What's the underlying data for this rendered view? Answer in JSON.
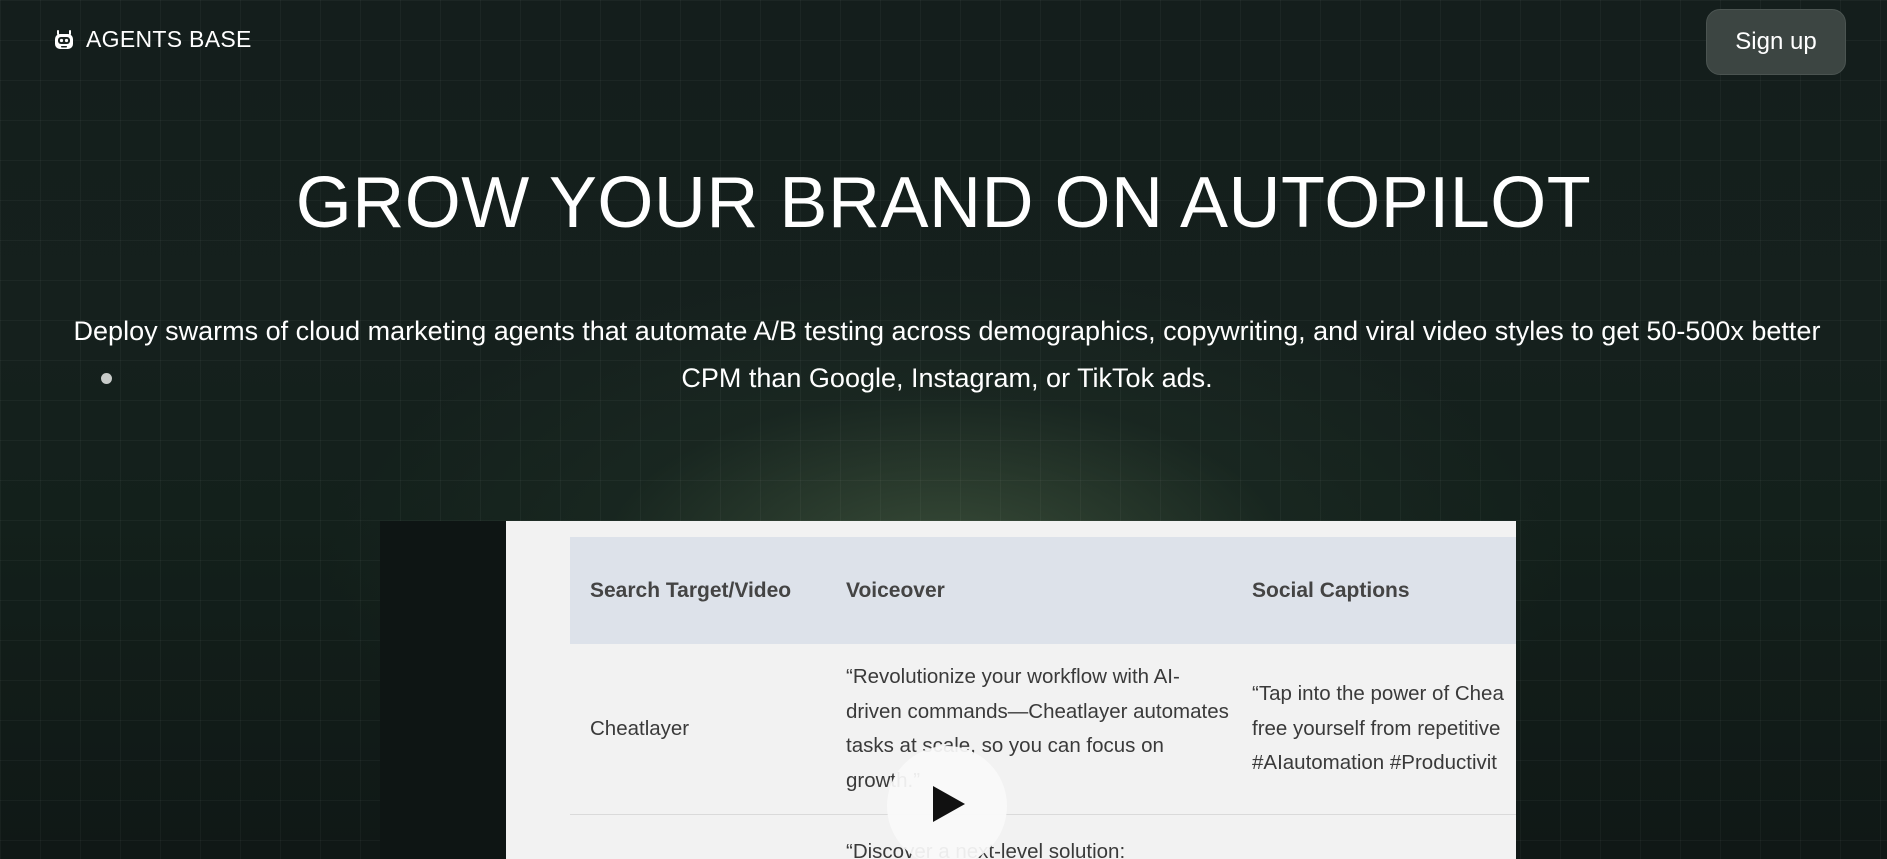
{
  "header": {
    "brand_name": "AGENTS BASE",
    "brand_icon": "robot-icon",
    "signup_label": "Sign up"
  },
  "hero": {
    "title": "GROW YOUR BRAND ON AUTOPILOT",
    "subtitle": "Deploy swarms of cloud marketing agents that automate A/B testing across demographics, copywriting, and viral video styles to get 50-500x better CPM than Google, Instagram, or TikTok ads."
  },
  "video": {
    "play_icon": "play-icon",
    "table": {
      "headers": [
        "Search Target/Video",
        "Voiceover",
        "Social Captions"
      ],
      "rows": [
        {
          "target": "Cheatlayer",
          "voiceover": "“Revolutionize your workflow with AI-driven commands—Cheatlayer automates tasks at scale, so you can focus on growth.”",
          "caption_lines": [
            "“Tap into the power of Chea",
            "free yourself from repetitive",
            "#AIautomation #Productivit"
          ]
        },
        {
          "target": "",
          "voiceover": "“Discover a next-level solution:",
          "caption_lines": []
        }
      ]
    }
  },
  "colors": {
    "background": "#111a18",
    "button": "#3c4542",
    "table_header": "#dde2ea"
  }
}
